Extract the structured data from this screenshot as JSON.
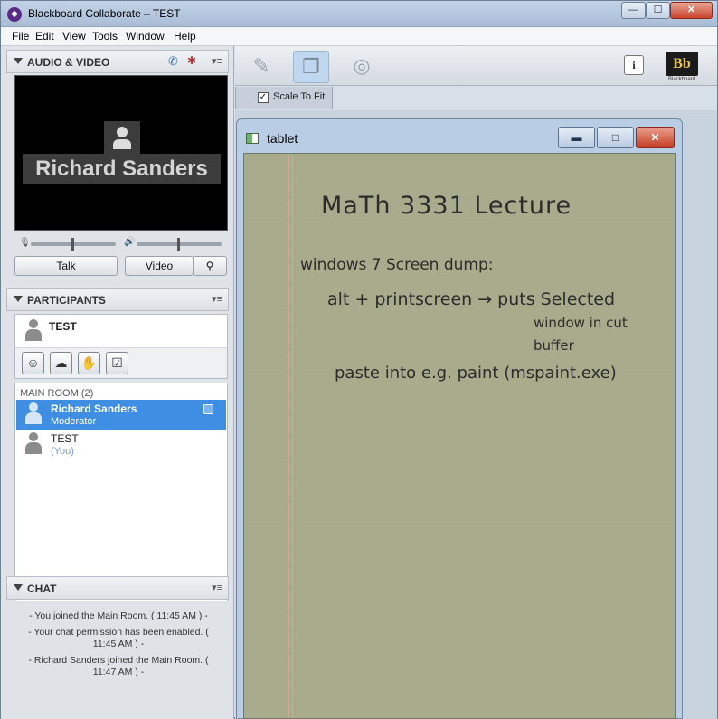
{
  "window": {
    "title": "Blackboard Collaborate – TEST",
    "min": "—",
    "max": "☐",
    "close": "✕"
  },
  "menu": [
    "File",
    "Edit",
    "View",
    "Tools",
    "Window",
    "Help"
  ],
  "audio_video": {
    "title": "AUDIO & VIDEO",
    "video_name": "Richard Sanders",
    "talk": "Talk",
    "video": "Video"
  },
  "participants": {
    "title": "PARTICIPANTS",
    "me": "TEST",
    "room": "MAIN ROOM",
    "count": "(2)",
    "list": [
      {
        "name": "Richard Sanders",
        "role": "Moderator"
      },
      {
        "name": "TEST",
        "role": "(You)"
      }
    ]
  },
  "chat": {
    "title": "CHAT",
    "messages": [
      "- You joined the Main Room. ( 11:45 AM ) -",
      "- Your chat permission has been enabled. ( 11:45 AM ) -",
      "- Richard Sanders joined the Main Room. ( 11:47 AM ) -"
    ]
  },
  "toolbar": {
    "info": "i",
    "logo": "Bb",
    "logo_text": "Blackboard"
  },
  "scale": {
    "label": "Scale To Fit",
    "checked": true
  },
  "tablet": {
    "title": "tablet",
    "lines": [
      "MaTh 3331 Lecture",
      "windows 7 Screen dump:",
      "alt + printscreen → puts Selected",
      "window in cut",
      "buffer",
      "paste into e.g. paint (mspaint.exe)"
    ]
  }
}
